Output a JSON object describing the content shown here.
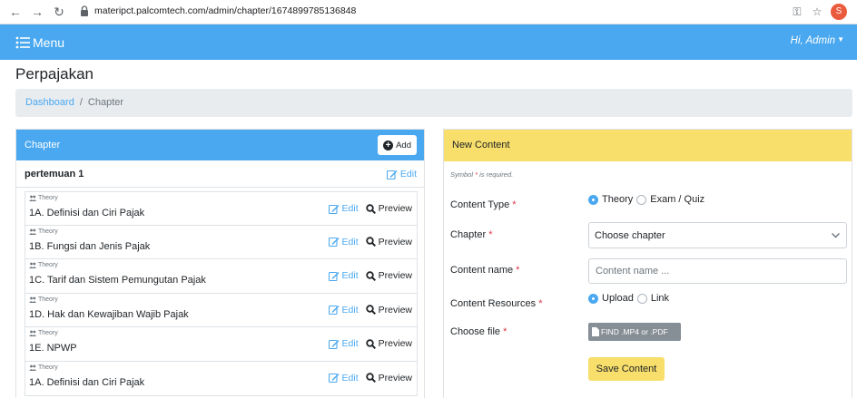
{
  "browser": {
    "url": "materipct.palcomtech.com/admin/chapter/1674899785136848",
    "profile_initial": "S"
  },
  "navbar": {
    "menu_label": "Menu",
    "user_label": "Hi, Admin",
    "accent": "#4aa8f0"
  },
  "page": {
    "title": "Perpajakan"
  },
  "breadcrumb": {
    "items": [
      "Dashboard",
      "Chapter"
    ],
    "separator": "/"
  },
  "chapter_panel": {
    "header": "Chapter",
    "add_label": "Add",
    "section_title": "pertemuan 1",
    "section_edit_label": "Edit",
    "edit_label": "Edit",
    "preview_label": "Preview",
    "items": [
      {
        "type": "Theory",
        "title": "1A. Definisi dan Ciri Pajak"
      },
      {
        "type": "Theory",
        "title": "1B. Fungsi dan Jenis Pajak"
      },
      {
        "type": "Theory",
        "title": "1C. Tarif dan Sistem Pemungutan Pajak"
      },
      {
        "type": "Theory",
        "title": "1D. Hak dan Kewajiban Wajib Pajak"
      },
      {
        "type": "Theory",
        "title": "1E. NPWP"
      },
      {
        "type": "Theory",
        "title": "1A. Definisi dan Ciri Pajak"
      }
    ]
  },
  "content_panel": {
    "header": "New Content",
    "header_color": "#f8de6b",
    "required_note_prefix": "Symbol",
    "required_note_suffix": "is required.",
    "required_symbol": "*",
    "content_type_label": "Content Type",
    "content_type_options": [
      "Theory",
      "Exam / Quiz"
    ],
    "content_type_selected": "Theory",
    "chapter_label": "Chapter",
    "chapter_value": "Choose chapter",
    "content_name_label": "Content name",
    "content_name_placeholder": "Content name ...",
    "content_name_value": "",
    "resources_label": "Content Resources",
    "resources_options": [
      "Upload",
      "Link"
    ],
    "resources_selected": "Upload",
    "choose_file_label": "Choose file",
    "file_button_label": "FIND .MP4 or .PDF",
    "save_label": "Save Content"
  }
}
